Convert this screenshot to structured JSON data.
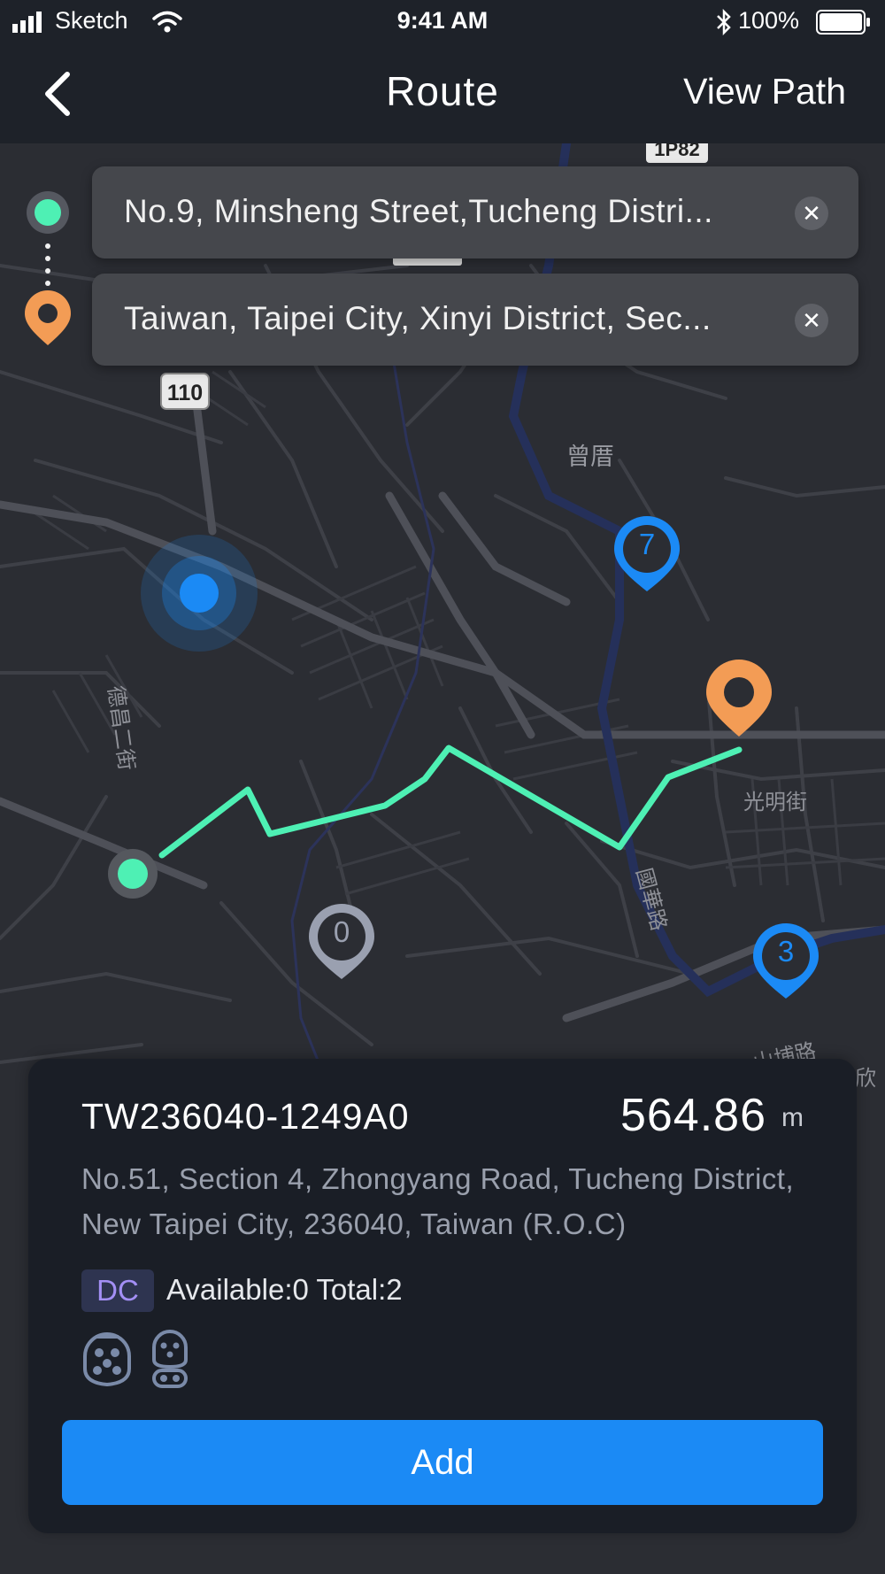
{
  "status_bar": {
    "carrier": "Sketch",
    "time": "9:41 AM",
    "battery": "100%"
  },
  "nav": {
    "title": "Route",
    "action": "View Path"
  },
  "route_inputs": {
    "origin": "No.9, Minsheng Street,Tucheng Distri...",
    "destination": "Taiwan, Taipei City, Xinyi District, Sec..."
  },
  "map": {
    "road_badges": [
      "1P82",
      "110"
    ],
    "labels": [
      "曾厝",
      "德昌二街",
      "光明街",
      "國華路",
      "山埔路",
      "欣"
    ],
    "markers": [
      "7",
      "0",
      "3"
    ],
    "colors": {
      "route_line": "#4ef0b4",
      "origin_marker": "#4ef0b4",
      "destination_marker": "#f39c55",
      "station_marker_blue": "#1b8af5",
      "station_marker_gray": "#9aa0b0",
      "location_dot": "#1b8af5"
    }
  },
  "station": {
    "id": "TW236040-1249A0",
    "distance": "564.86",
    "distance_unit": "m",
    "address": "No.51, Section 4, Zhongyang Road, Tucheng District, New Taipei City, 236040, Taiwan (R.O.C)",
    "type_badge": "DC",
    "availability": "Available:0 Total:2",
    "connectors": [
      "type2-connector-icon",
      "ccs-connector-icon"
    ],
    "add_label": "Add"
  },
  "icons": {
    "back": "back-chevron-icon",
    "clear": "close-icon",
    "wifi": "wifi-icon",
    "signal": "signal-icon",
    "bluetooth": "bluetooth-icon",
    "battery": "battery-icon"
  }
}
